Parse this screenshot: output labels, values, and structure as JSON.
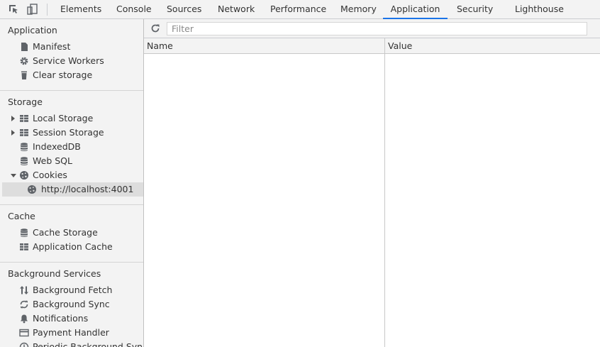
{
  "toolbar": {
    "tabs": [
      {
        "label": "Elements"
      },
      {
        "label": "Console"
      },
      {
        "label": "Sources"
      },
      {
        "label": "Network"
      },
      {
        "label": "Performance"
      },
      {
        "label": "Memory"
      },
      {
        "label": "Application",
        "active": true
      },
      {
        "label": "Security"
      },
      {
        "label": "Lighthouse"
      }
    ]
  },
  "sidebar": {
    "application": {
      "title": "Application",
      "items": [
        {
          "label": "Manifest",
          "icon": "document-icon"
        },
        {
          "label": "Service Workers",
          "icon": "gear-icon"
        },
        {
          "label": "Clear storage",
          "icon": "trash-icon"
        }
      ]
    },
    "storage": {
      "title": "Storage",
      "items": [
        {
          "label": "Local Storage",
          "icon": "table-icon",
          "expander": "collapsed"
        },
        {
          "label": "Session Storage",
          "icon": "table-icon",
          "expander": "collapsed"
        },
        {
          "label": "IndexedDB",
          "icon": "database-icon"
        },
        {
          "label": "Web SQL",
          "icon": "database-icon"
        },
        {
          "label": "Cookies",
          "icon": "cookie-icon",
          "expander": "expanded"
        },
        {
          "label": "http://localhost:4001",
          "icon": "cookie-icon",
          "selected": true
        }
      ]
    },
    "cache": {
      "title": "Cache",
      "items": [
        {
          "label": "Cache Storage",
          "icon": "database-icon"
        },
        {
          "label": "Application Cache",
          "icon": "table-icon"
        }
      ]
    },
    "background": {
      "title": "Background Services",
      "items": [
        {
          "label": "Background Fetch",
          "icon": "up-down-arrows-icon"
        },
        {
          "label": "Background Sync",
          "icon": "sync-icon"
        },
        {
          "label": "Notifications",
          "icon": "bell-icon"
        },
        {
          "label": "Payment Handler",
          "icon": "card-icon"
        },
        {
          "label": "Periodic Background Sync",
          "icon": "clock-icon"
        }
      ]
    }
  },
  "main": {
    "filter": {
      "placeholder": "Filter",
      "value": ""
    },
    "columns": {
      "name": "Name",
      "value": "Value"
    }
  },
  "colors": {
    "accent": "#1a73e8",
    "selected_row": "#dddddd",
    "panel_bg": "#f3f3f3"
  }
}
